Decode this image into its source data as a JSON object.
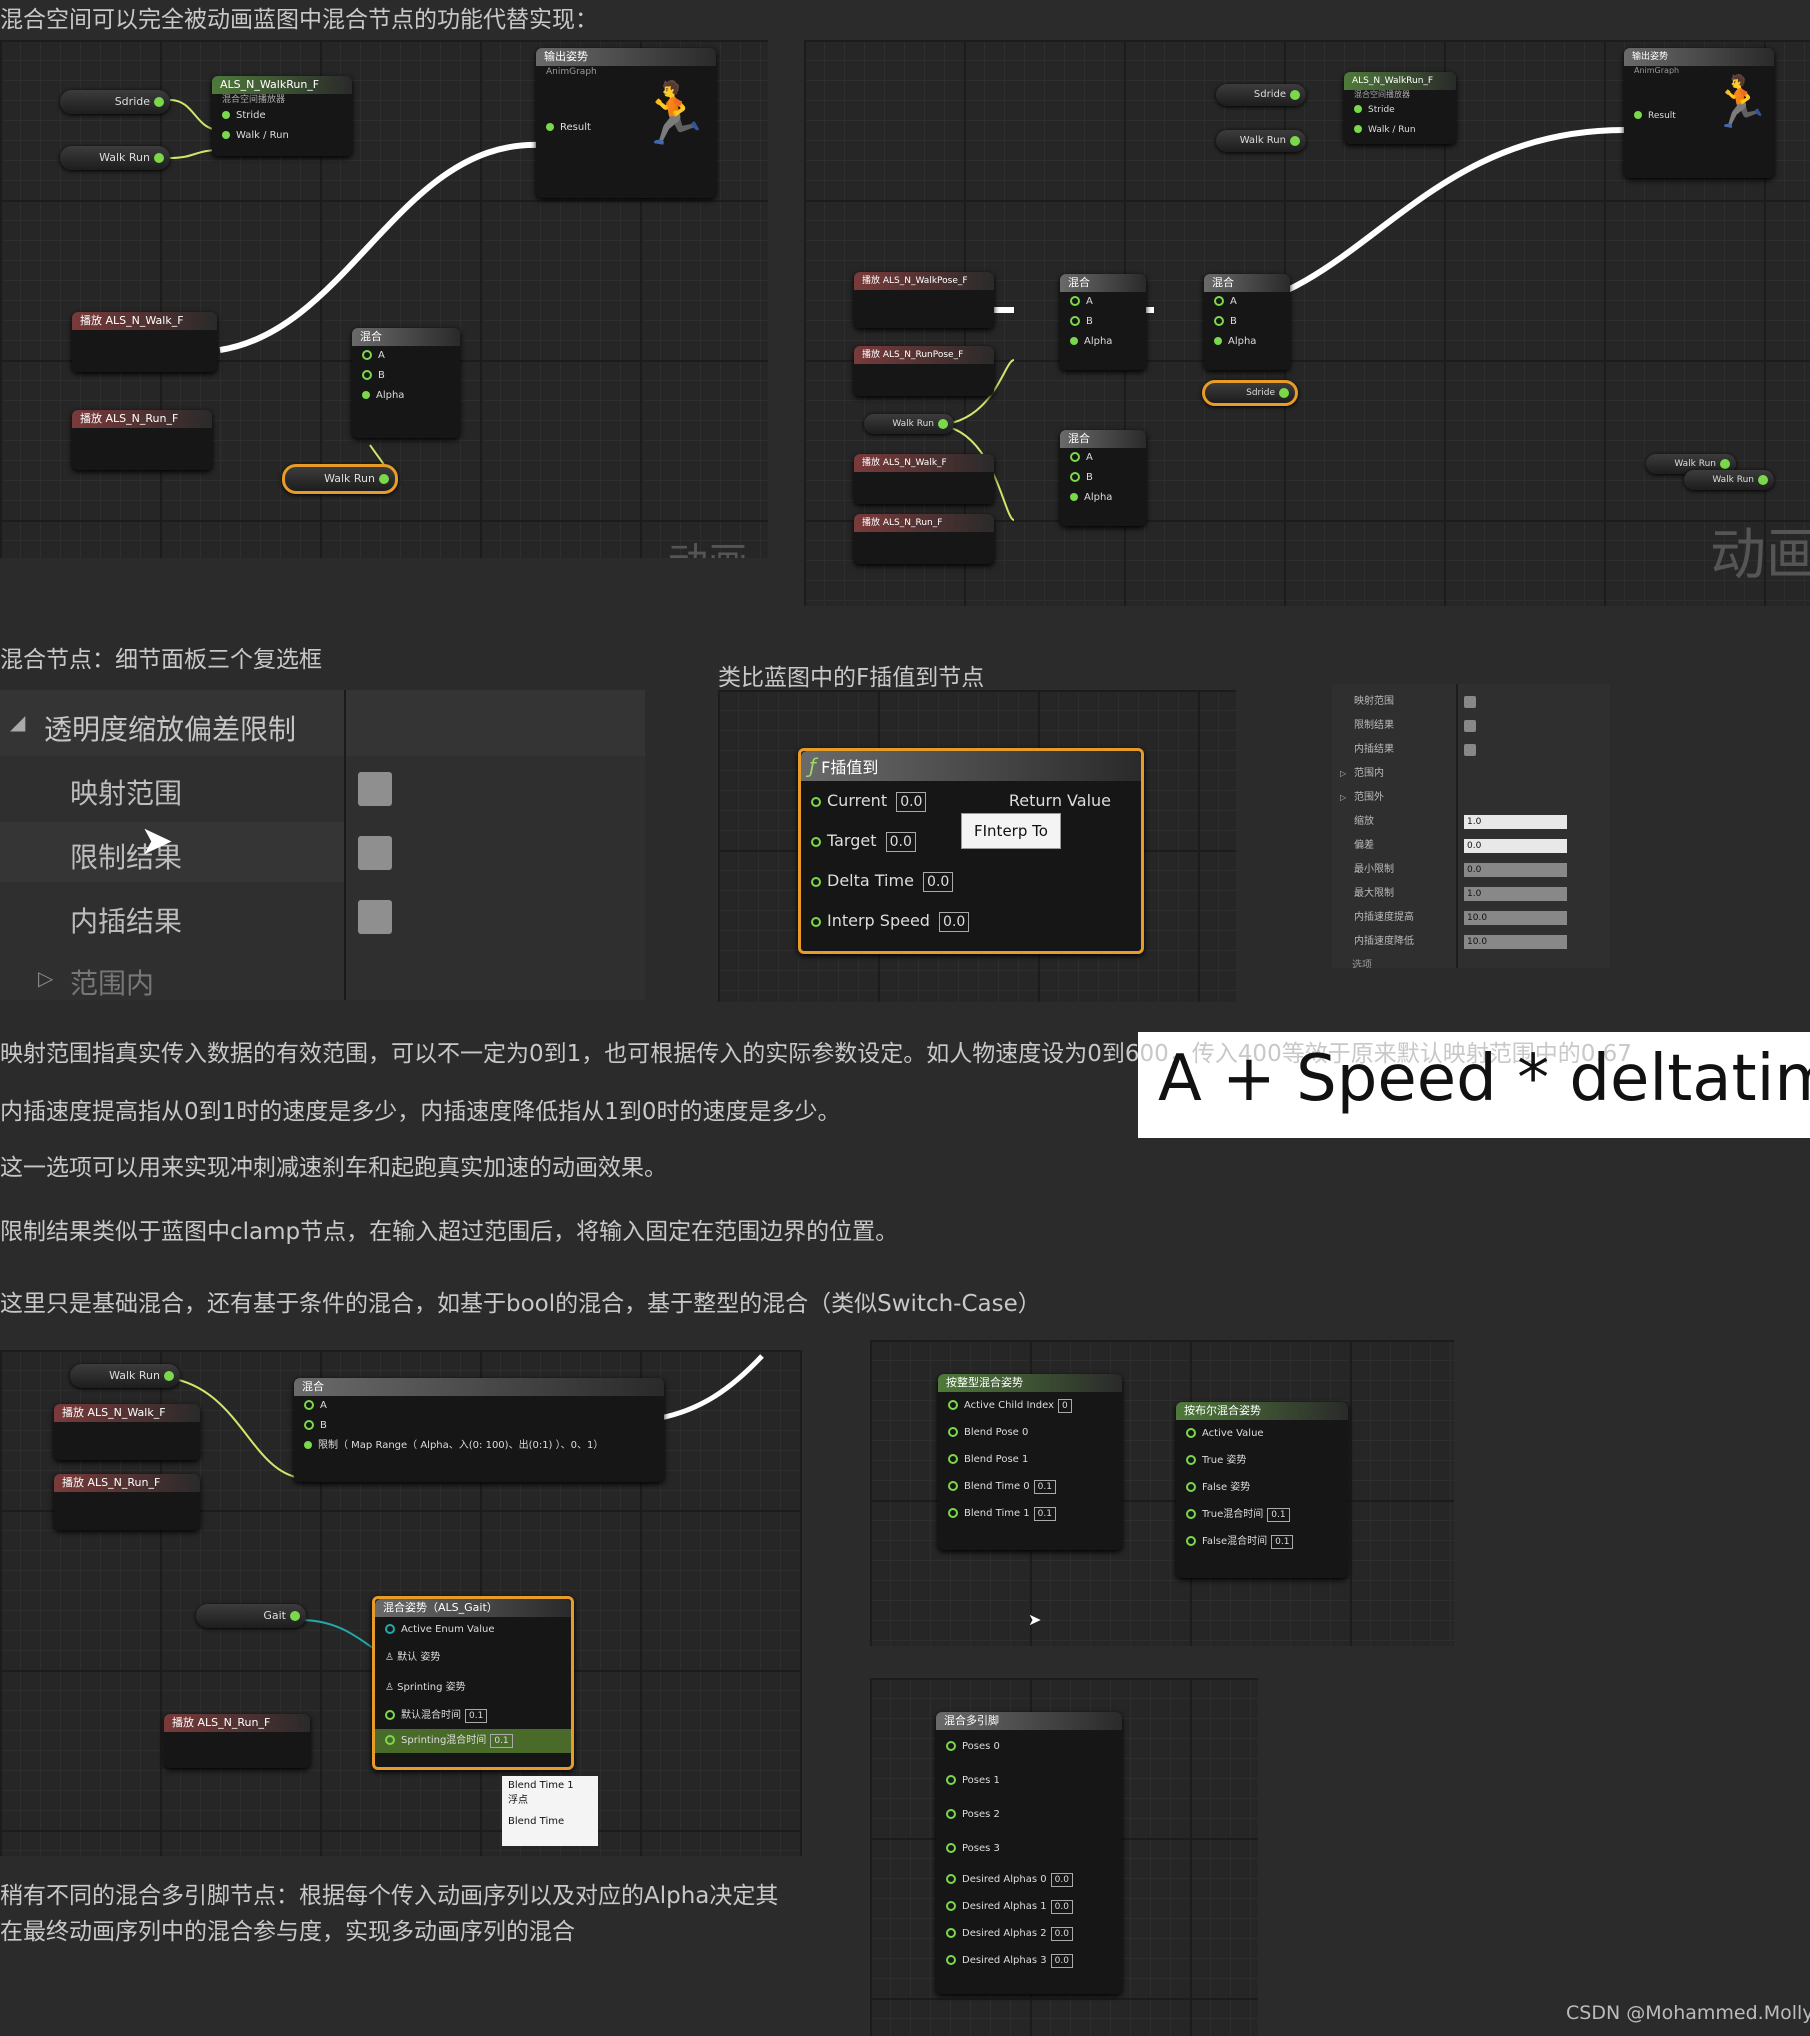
{
  "header_text": "混合空间可以完全被动画蓝图中混合节点的功能代替实现：",
  "fig1": {
    "bs_node": {
      "title": "ALS_N_WalkRun_F",
      "sub": "混合空间播放器",
      "pins": [
        "Stride",
        "Walk / Run"
      ]
    },
    "var_sdride": "Sdride",
    "var_walkrun": "Walk Run",
    "output": {
      "title": "输出姿势",
      "sub": "AnimGraph",
      "pin": "Result"
    },
    "play_walk": "播放 ALS_N_Walk_F",
    "play_run": "播放 ALS_N_Run_F",
    "blend": {
      "title": "混合",
      "pins": [
        "A",
        "B",
        "Alpha"
      ]
    },
    "watermark": "动画"
  },
  "fig2": {
    "bs_node": {
      "title": "ALS_N_WalkRun_F",
      "sub": "混合空间播放器",
      "pins": [
        "Stride",
        "Walk / Run"
      ]
    },
    "var_sdride": "Sdride",
    "var_walkrun": "Walk Run",
    "output": {
      "title": "输出姿势",
      "sub": "AnimGraph",
      "pin": "Result"
    },
    "play_walkpose": "播放 ALS_N_WalkPose_F",
    "play_runpose": "播放 ALS_N_RunPose_F",
    "play_walk": "播放 ALS_N_Walk_F",
    "play_run": "播放 ALS_N_Run_F",
    "blend_title": "混合",
    "blend_pins": [
      "A",
      "B",
      "Alpha"
    ],
    "watermark": "动画"
  },
  "section2_caption": "混合节点：细节面板三个复选框",
  "details": {
    "category": "透明度缩放偏差限制",
    "rows": [
      "映射范围",
      "限制结果",
      "内插结果"
    ],
    "collapsed": "范围内"
  },
  "finterp_caption": "类比蓝图中的F插值到节点",
  "finterp": {
    "title": "F插值到",
    "return": "Return Value",
    "inputs": [
      {
        "label": "Current",
        "value": "0.0"
      },
      {
        "label": "Target",
        "value": "0.0"
      },
      {
        "label": "Delta Time",
        "value": "0.0"
      },
      {
        "label": "Interp Speed",
        "value": "0.0"
      }
    ],
    "tooltip": "FInterp To"
  },
  "small_details": {
    "rows": [
      {
        "label": "映射范围",
        "kind": "check"
      },
      {
        "label": "限制结果",
        "kind": "check"
      },
      {
        "label": "内插结果",
        "kind": "check"
      },
      {
        "label": "范围内",
        "kind": "expand"
      },
      {
        "label": "范围外",
        "kind": "expand"
      },
      {
        "label": "缩放",
        "value": "1.0"
      },
      {
        "label": "偏差",
        "value": "0.0"
      },
      {
        "label": "最小限制",
        "value": "0.0"
      },
      {
        "label": "最大限制",
        "value": "1.0"
      },
      {
        "label": "内插速度提高",
        "value": "10.0"
      },
      {
        "label": "内插速度降低",
        "value": "10.0"
      }
    ],
    "footer": "选项"
  },
  "formula": "A + Speed * deltatime",
  "para1": "映射范围指真实传入数据的有效范围，可以不一定为0到1，也可根据传入的实际参数设定。如人物速度设为0到600，传入400等效于原来默认映射范围中的0.67",
  "para2": "内插速度提高指从0到1时的速度是多少，内插速度降低指从1到0时的速度是多少。",
  "para3": "这一选项可以用来实现冲刺减速刹车和起跑真实加速的动画效果。",
  "para4": "限制结果类似于蓝图中clamp节点，在输入超过范围后，将输入固定在范围边界的位置。",
  "para5": "这里只是基础混合，还有基于条件的混合，如基于bool的混合，基于整型的混合（类似Switch-Case）",
  "fig3": {
    "var_walkrun": "Walk Run",
    "play_walk": "播放 ALS_N_Walk_F",
    "play_run": "播放 ALS_N_Run_F",
    "play_run2": "播放 ALS_N_Run_F",
    "blend": {
      "title": "混合",
      "pins": [
        "A",
        "B"
      ],
      "alpha": "限制（ Map Range（ Alpha、入(0: 100)、出(0:1) ）、0、1）"
    },
    "gait_var": "Gait",
    "enum_node": {
      "title": "混合姿势（ALS_Gait）",
      "rows": [
        "Active Enum Value",
        "默认 姿势",
        "Sprinting 姿势",
        "默认混合时间",
        "Sprinting混合时间"
      ],
      "times": [
        "0.1",
        "0.1"
      ]
    },
    "tooltip": [
      "Blend Time 1",
      "浮点",
      "Blend Time"
    ]
  },
  "int_node": {
    "title": "按整型混合姿势",
    "rows": [
      {
        "label": "Active Child Index",
        "value": "0"
      },
      {
        "label": "Blend Pose 0"
      },
      {
        "label": "Blend Pose 1"
      },
      {
        "label": "Blend Time 0",
        "value": "0.1"
      },
      {
        "label": "Blend Time 1",
        "value": "0.1"
      }
    ]
  },
  "bool_node": {
    "title": "按布尔混合姿势",
    "rows": [
      {
        "label": "Active Value"
      },
      {
        "label": "True 姿势"
      },
      {
        "label": "False 姿势"
      },
      {
        "label": "True混合时间",
        "value": "0.1"
      },
      {
        "label": "False混合时间",
        "value": "0.1"
      }
    ]
  },
  "multi_node": {
    "title": "混合多引脚",
    "poses": [
      "Poses 0",
      "Poses 1",
      "Poses 2",
      "Poses 3"
    ],
    "alphas": [
      {
        "label": "Desired Alphas 0",
        "value": "0.0"
      },
      {
        "label": "Desired Alphas 1",
        "value": "0.0"
      },
      {
        "label": "Desired Alphas 2",
        "value": "0.0"
      },
      {
        "label": "Desired Alphas 3",
        "value": "0.0"
      }
    ]
  },
  "bottom_text_line1": "稍有不同的混合多引脚节点：根据每个传入动画序列以及对应的Alpha决定其",
  "bottom_text_line2": "在最终动画序列中的混合参与度，实现多动画序列的混合",
  "credit": "CSDN @Mohammed.Molly"
}
